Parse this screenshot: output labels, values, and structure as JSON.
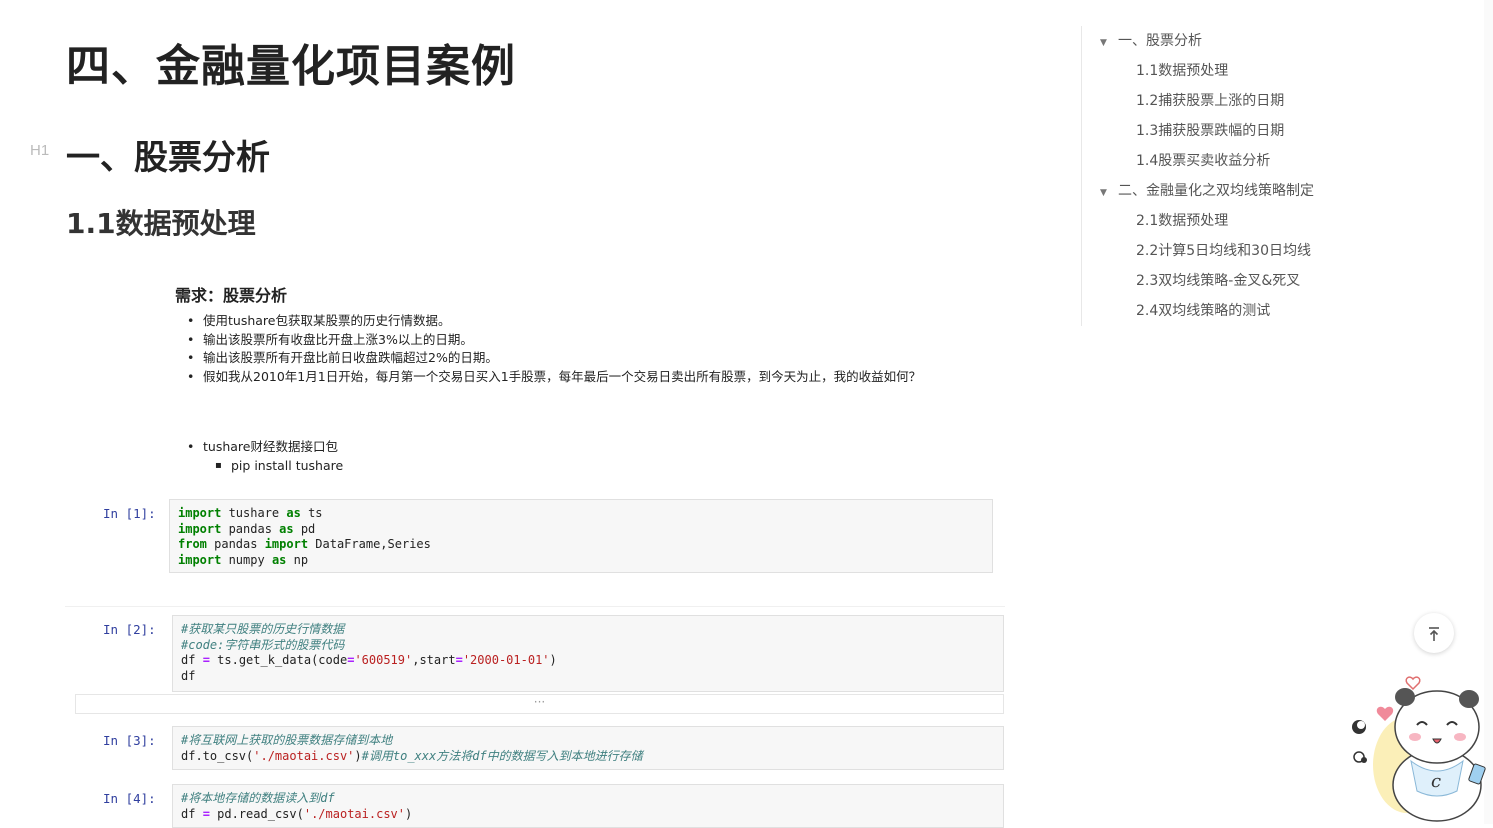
{
  "article": {
    "page_title": "四、金融量化项目案例",
    "h1_marker": "H1",
    "h1": "一、股票分析",
    "h2": "1.1数据预处理"
  },
  "requirements": {
    "title": "需求：股票分析",
    "items": [
      "使用tushare包获取某股票的历史行情数据。",
      "输出该股票所有收盘比开盘上涨3%以上的日期。",
      "输出该股票所有开盘比前日收盘跌幅超过2%的日期。",
      "假如我从2010年1月1日开始，每月第一个交易日买入1手股票，每年最后一个交易日卖出所有股票，到今天为止，我的收益如何？"
    ],
    "tools_item": "tushare财经数据接口包",
    "tools_sub": "pip install tushare"
  },
  "cells": [
    {
      "prompt": "In [1]:"
    },
    {
      "prompt": "In [2]:",
      "comment1": "#获取某只股票的历史行情数据",
      "comment2": "#code:字符串形式的股票代码"
    },
    {
      "prompt": "In [3]:",
      "comment1": "#将互联网上获取的股票数据存储到本地",
      "comment2": "#调用to_xxx方法将df中的数据写入到本地进行存储"
    },
    {
      "prompt": "In [4]:",
      "comment1": "#将本地存储的数据读入到df"
    }
  ],
  "collapsed_output": "···",
  "toc": {
    "items": [
      {
        "label": "一、股票分析",
        "level": 1,
        "expanded": true
      },
      {
        "label": "1.1数据预处理",
        "level": 2
      },
      {
        "label": "1.2捕获股票上涨的日期",
        "level": 2
      },
      {
        "label": "1.3捕获股票跌幅的日期",
        "level": 2
      },
      {
        "label": "1.4股票买卖收益分析",
        "level": 2
      },
      {
        "label": "二、金融量化之双均线策略制定",
        "level": 1,
        "expanded": true
      },
      {
        "label": "2.1数据预处理",
        "level": 2
      },
      {
        "label": "2.2计算5日均线和30日均线",
        "level": 2
      },
      {
        "label": "2.3双均线策略-金叉&死叉",
        "level": 2
      },
      {
        "label": "2.4双均线策略的测试",
        "level": 2
      }
    ]
  },
  "icons": {
    "back_to_top": "arrow-up-to-line-icon",
    "toc_caret": "caret-down-icon",
    "mascot": "cartoon-mascot-icon"
  }
}
